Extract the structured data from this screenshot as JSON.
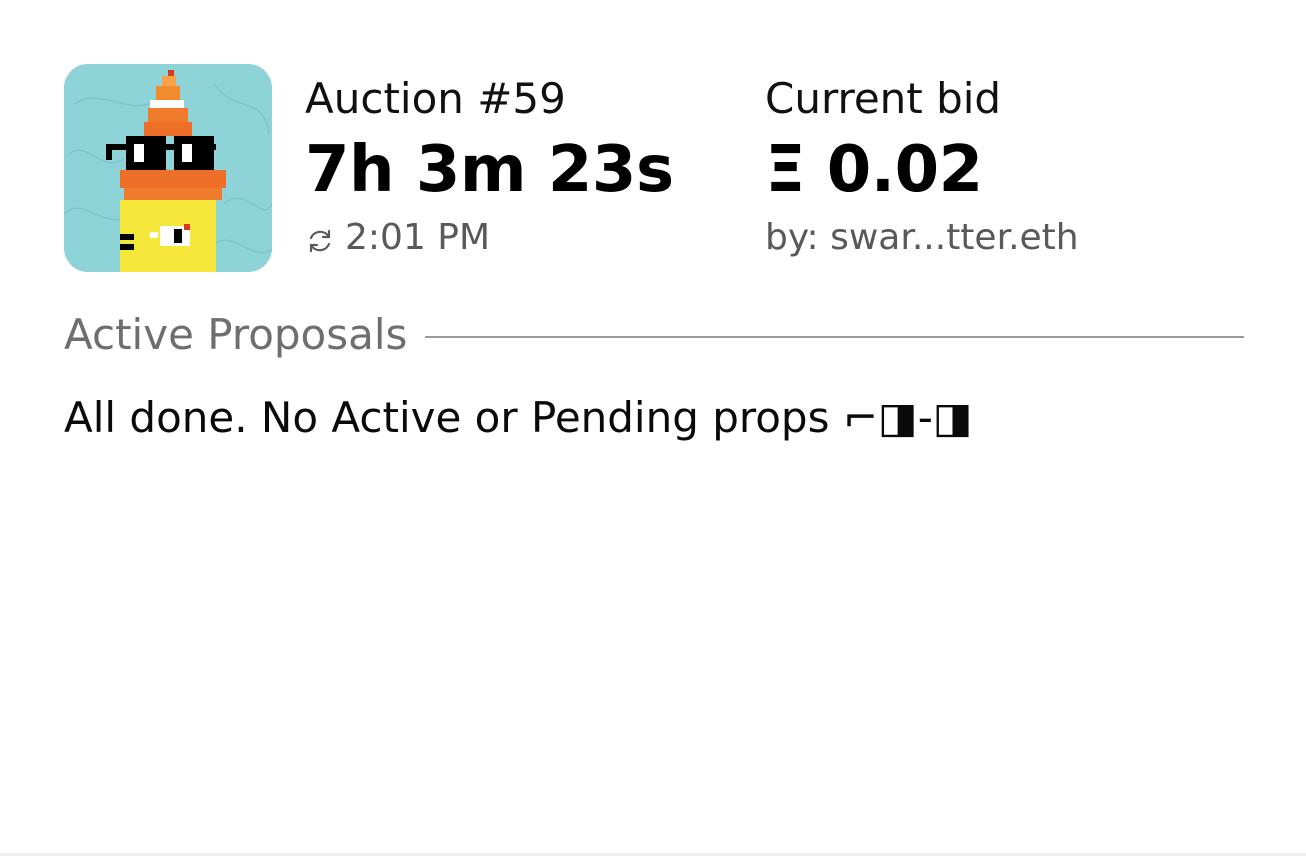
{
  "auction": {
    "title": "Auction #59",
    "countdown": "7h 3m 23s",
    "end_time": "2:01 PM",
    "avatar_alt": "noun avatar"
  },
  "bid": {
    "title": "Current bid",
    "amount": "Ξ 0.02",
    "bidder": "by: swar...tter.eth"
  },
  "proposals": {
    "section_title": "Active Proposals",
    "empty_message": "All done. No Active or Pending props ⌐◨-◨"
  },
  "colors": {
    "avatar_background": "#8dd3d8",
    "text_primary": "#000000",
    "text_secondary": "#595959",
    "divider": "#9a9a9a"
  },
  "icons": {
    "refresh": "refresh-icon"
  }
}
